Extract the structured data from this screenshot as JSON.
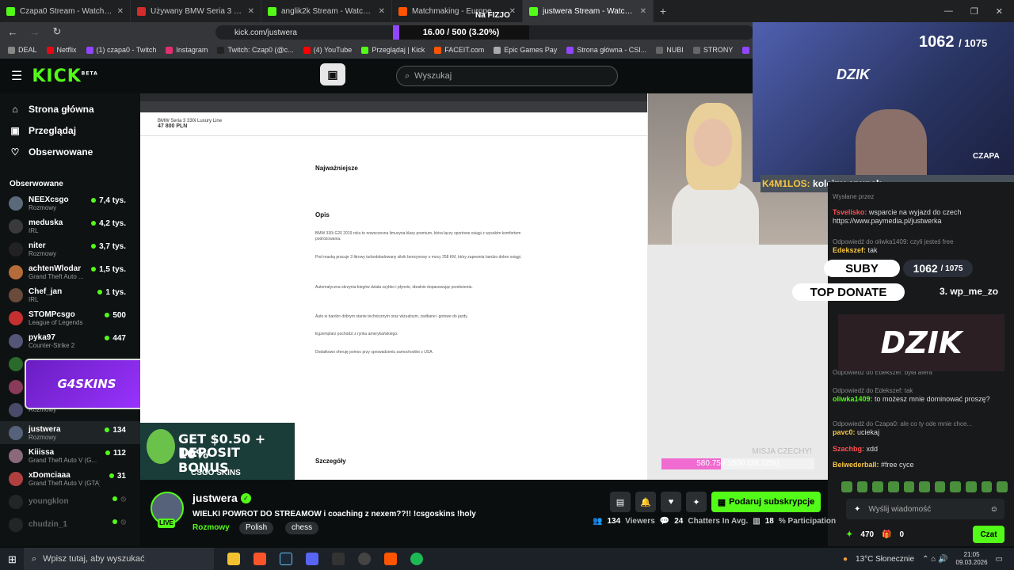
{
  "browser": {
    "tabs": [
      {
        "title": "Czapa0 Stream - Watch Live on K",
        "color": "#53fc18",
        "active": false
      },
      {
        "title": "Używany BMW Seria 3 2019 - 47 800",
        "color": "#d32c2c",
        "active": false
      },
      {
        "title": "anglik2k Stream - Watch Live on Kick",
        "color": "#53fc18",
        "active": false
      },
      {
        "title": "Matchmaking - Europe 5v5 Queue",
        "color": "#ff5500",
        "active": false
      },
      {
        "title": "justwera Stream - Watch Live",
        "color": "#53fc18",
        "active": true
      }
    ],
    "url": "kick.com/justwera",
    "bookmarks": [
      {
        "label": "DEAL",
        "color": "#888"
      },
      {
        "label": "Netflix",
        "color": "#e50914"
      },
      {
        "label": "(1) czapa0 - Twitch",
        "color": "#9146ff"
      },
      {
        "label": "Instagram",
        "color": "#e1306c"
      },
      {
        "label": "Twitch: Czap0 (@c...",
        "color": "#222"
      },
      {
        "label": "(4) YouTube",
        "color": "#ff0000"
      },
      {
        "label": "Przeglądaj | Kick",
        "color": "#53fc18"
      },
      {
        "label": "FACEIT.com",
        "color": "#ff5500"
      },
      {
        "label": "Epic Games Pay",
        "color": "#aaa"
      },
      {
        "label": "Strona główna - CSI...",
        "color": "#9146ff"
      },
      {
        "label": "NUBI",
        "color": "#666"
      },
      {
        "label": "STRONY",
        "color": "#666"
      },
      {
        "label": "Skrzynki CS2",
        "color": "#9146ff"
      }
    ]
  },
  "kick": {
    "logo": "KICK",
    "logo_sup": "BETA",
    "search_placeholder": "Wyszukaj",
    "nav": [
      {
        "label": "Strona główna",
        "icon": "home-icon"
      },
      {
        "label": "Przeglądaj",
        "icon": "browse-icon"
      },
      {
        "label": "Obserwowane",
        "icon": "heart-icon"
      }
    ],
    "followed_title": "Obserwowane",
    "channels": [
      {
        "name": "NEEXcsgo",
        "category": "Rozmowy",
        "viewers": "7,4 tys.",
        "color": "#5a6a7a",
        "online": true
      },
      {
        "name": "meduska",
        "category": "IRL",
        "viewers": "4,2 tys.",
        "color": "#3a3a3a",
        "online": true
      },
      {
        "name": "niter",
        "category": "Rozmowy",
        "viewers": "3,7 tys.",
        "color": "#222",
        "online": true
      },
      {
        "name": "achtenWlodar",
        "category": "Grand Theft Auto ...",
        "viewers": "1,5 tys.",
        "color": "#b56b3a",
        "online": true
      },
      {
        "name": "Chef_jan",
        "category": "IRL",
        "viewers": "1 tys.",
        "color": "#6a4a3a",
        "online": true
      },
      {
        "name": "STOMPcsgo",
        "category": "League of Legends",
        "viewers": "500",
        "color": "#c43030",
        "online": true
      },
      {
        "name": "pyka97",
        "category": "Counter-Strike 2",
        "viewers": "447",
        "color": "#557",
        "online": true
      },
      {
        "name": "",
        "category": "",
        "viewers": "",
        "color": "#2a6a2a",
        "online": true
      },
      {
        "name": "",
        "category": "",
        "viewers": "",
        "color": "#8a3a5a",
        "online": true
      },
      {
        "name": "",
        "category": "Rozmowy",
        "viewers": "134",
        "color": "#4a4a6a",
        "online": true
      },
      {
        "name": "justwera",
        "category": "Rozmowy",
        "viewers": "134",
        "color": "#55627a",
        "online": true,
        "selected": true
      },
      {
        "name": "Kiiissa",
        "category": "Grand Theft Auto V (G...",
        "viewers": "112",
        "color": "#8a6a7a",
        "online": true
      },
      {
        "name": "xDomciaaa",
        "category": "Grand Theft Auto V (GTA)",
        "viewers": "31",
        "color": "#b04040",
        "online": true
      },
      {
        "name": "youngklon",
        "category": "",
        "viewers": "",
        "color": "#444",
        "online": false
      },
      {
        "name": "chudzin_1",
        "category": "",
        "viewers": "",
        "color": "#444",
        "online": false
      }
    ],
    "sponsor_g4": "G4SKINS"
  },
  "stream_content": {
    "listing_title": "BMW Seria 3 330i Luxury Line",
    "listing_price": "47 800 PLN",
    "section_najw": "Najważniejsze",
    "section_opis": "Opis",
    "section_szcz": "Szczegóły",
    "paragraphs": [
      "BMW 330i G20 2019 roku to nowoczesna limuzyna klasy premium, która łączy sportowe osiągi z wysokim komfortem podróżowania.",
      "Pod maską pracuje 2-litrowy turbodoładowany silnik benzynowy o mocy 258 KM, który zapewnia bardzo dobre osiągi.",
      "Automatyczna skrzynia biegów działa szybko i płynnie, idealnie dopasowując przełożenia.",
      "Auto w bardzo dobrym stanie technicznym oraz wizualnym, zadbane i gotowe do jazdy.",
      "Egzemplarz pochodzi z rynku amerykańskiego.",
      "Dodatkowo oferuję pomoc przy sprowadzeniu samochodów z USA."
    ],
    "csgo_line1": "GET $0.50 + 10%",
    "csgo_line2": "DEPOSIT BONUS",
    "csgo_brand": "CSGO SKINS",
    "misja_label": "MISJA CZECHY!",
    "misja_text": "580.75 / 1500 (38.72%)",
    "misja_progress": 0.3872,
    "top_goal": "16.00 / 500 (3.20%)",
    "top_goal_label": "Na FIZJO"
  },
  "overlay": {
    "subs": "1062",
    "subs_goal": "/ 1075",
    "brand": "DZIK",
    "name": "CZAPA",
    "strip_user": "K4M1LOS:",
    "strip_text": "kolejny cpunek"
  },
  "chat": {
    "messages": [
      {
        "reply": "Wysłane przez",
        "user": "",
        "text": ""
      },
      {
        "reply": "",
        "user": "Tsvelisko:",
        "text": "wsparcie na wyjazd do czech https://www.paymedia.pl/justwerka"
      },
      {
        "reply": "Odpowiedź do oliwka1409: czyli jesteś free",
        "user": "Edekszef:",
        "text": "tak"
      },
      {
        "reply": "Odpowiedź do Edekszef: była afera",
        "user": "",
        "text": ""
      },
      {
        "reply": "Odpowiedź do Edekszef: tak",
        "user": "oliwka1409:",
        "text": "to możesz mnie dominować proszę?"
      },
      {
        "reply": "Odpowiedź do Czapa0: ale co ty ode mnie chce...",
        "user": "pavc0:",
        "text": "uciekaj"
      },
      {
        "reply": "",
        "user": "Szachbg:",
        "text": "xdd"
      },
      {
        "reply": "",
        "user": "Belwederball:",
        "text": "#free cyce"
      }
    ],
    "label_suby": "SUBY",
    "subs_num": "1062",
    "subs_goal": "/ 1075",
    "label_top": "TOP DONATE",
    "top_user": "3. wp_me_zo",
    "dzik_banner": "DZIK",
    "input_placeholder": "Wyślij wiadomość",
    "points": "470",
    "gifts": "0",
    "send_label": "Czat"
  },
  "streamer": {
    "name": "justwera",
    "title": "WIELKI POWROT DO STREAMOW i coaching z nexem??!! !csgoskins !holy",
    "category": "Rozmowy",
    "tags": [
      "Polish",
      "chess"
    ],
    "live": "LIVE",
    "sub_button": "Podaruj subskrypcje",
    "viewers": "134",
    "viewers_label": "Viewers",
    "chatters": "24",
    "chatters_label": "Chatters In Avg.",
    "participation": "18",
    "participation_label": "% Participation"
  },
  "taskbar": {
    "search_placeholder": "Wpisz tutaj, aby wyszukać",
    "weather": "13°C  Słonecznie",
    "time": "21:05",
    "date": "09.03.2026"
  }
}
